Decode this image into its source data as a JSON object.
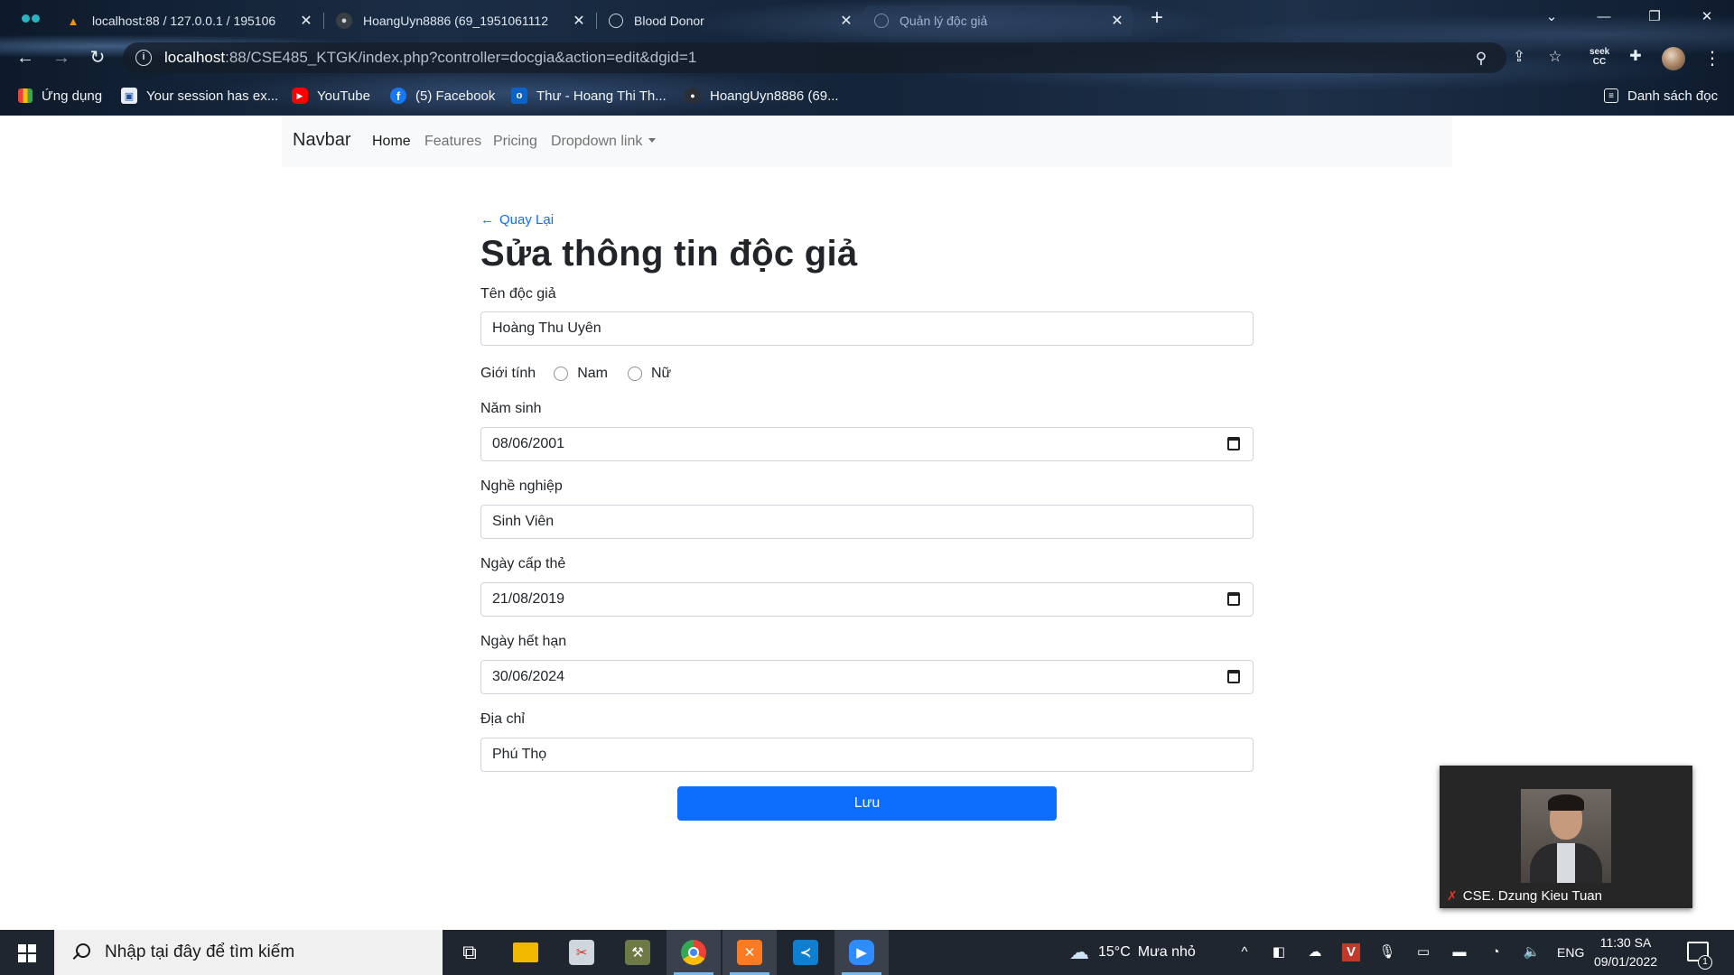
{
  "browser": {
    "tabs": [
      {
        "title": "localhost:88 / 127.0.0.1 / 195106",
        "favicon": "phpmyadmin-icon",
        "active": false
      },
      {
        "title": "HoangUyn8886 (69_1951061112",
        "favicon": "github-icon",
        "active": false
      },
      {
        "title": "Blood Donor",
        "favicon": "globe-icon",
        "active": false
      },
      {
        "title": "Quản lý độc giả",
        "favicon": "globe-icon",
        "active": true
      }
    ],
    "url_host": "localhost",
    "url_rest": ":88/CSE485_KTGK/index.php?controller=docgia&action=edit&dgid=1",
    "bookmarks": [
      {
        "label": "Ứng dụng",
        "icon": "apps-grid-icon"
      },
      {
        "label": "Your session has ex...",
        "icon": "session-icon"
      },
      {
        "label": "YouTube",
        "icon": "youtube-icon"
      },
      {
        "label": "(5) Facebook",
        "icon": "facebook-icon"
      },
      {
        "label": "Thư - Hoang Thi Th...",
        "icon": "outlook-icon"
      },
      {
        "label": "HoangUyn8886 (69...",
        "icon": "github-icon"
      }
    ],
    "reading_list": "Danh sách đọc"
  },
  "navbar": {
    "brand": "Navbar",
    "links": [
      "Home",
      "Features",
      "Pricing",
      "Dropdown link"
    ]
  },
  "form": {
    "back_label": "Quay Lại",
    "back_arrow": "←",
    "title": "Sửa thông tin độc giả",
    "name_label": "Tên độc giả",
    "name_value": "Hoàng Thu Uyên",
    "gender_label": "Giới tính",
    "gender_male": "Nam",
    "gender_female": "Nữ",
    "birth_label": "Năm sinh",
    "birth_value": "08/06/2001",
    "job_label": "Nghề nghiệp",
    "job_value": "Sinh Viên",
    "issue_label": "Ngày cấp thẻ",
    "issue_value": "21/08/2019",
    "expiry_label": "Ngày hết hạn",
    "expiry_value": "30/06/2024",
    "address_label": "Địa chỉ",
    "address_value": "Phú Thọ",
    "submit_label": "Lưu",
    "accent_color": "#0d6efd"
  },
  "video": {
    "participant": "CSE. Dzung Kieu Tuan"
  },
  "taskbar": {
    "search_placeholder": "Nhập tại đây để tìm kiếm",
    "weather_temp": "15°C",
    "weather_text": "Mưa nhỏ",
    "language": "ENG",
    "time": "11:30 SA",
    "date": "09/01/2022",
    "notification_count": "1"
  }
}
